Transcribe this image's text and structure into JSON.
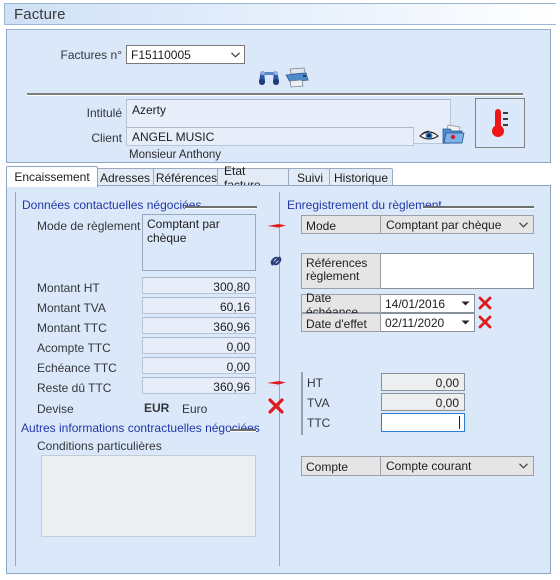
{
  "window": {
    "title": "Facture"
  },
  "header": {
    "facture_no_label": "Factures n°",
    "facture_no_value": "F15110005",
    "intitule_label": "Intitulé",
    "intitule_value": "Azerty",
    "client_label": "Client",
    "client_value": "ANGEL MUSIC",
    "client_contact": "Monsieur Anthony",
    "icons": {
      "search": "binoculars-icon",
      "print": "printer-icon",
      "preview": "eye-icon",
      "folder": "folder-icon",
      "thermometer": "thermometer-icon"
    }
  },
  "tabs": [
    {
      "label": "Encaissement",
      "active": true
    },
    {
      "label": "Adresses",
      "active": false
    },
    {
      "label": "Références",
      "active": false
    },
    {
      "label": "Etat facture",
      "active": false
    },
    {
      "label": "Suivi",
      "active": false
    },
    {
      "label": "Historique",
      "active": false
    }
  ],
  "left": {
    "group_title": "Données contactuelles négociées",
    "mode_label": "Mode de règlement",
    "mode_value": "Comptant par chèque",
    "amounts": [
      {
        "label": "Montant HT",
        "value": "300,80"
      },
      {
        "label": "Montant TVA",
        "value": "60,16"
      },
      {
        "label": "Montant TTC",
        "value": "360,96"
      },
      {
        "label": "Acompte TTC",
        "value": "0,00"
      },
      {
        "label": "Echéance TTC",
        "value": "0,00"
      },
      {
        "label": "Reste dû TTC",
        "value": "360,96"
      }
    ],
    "devise_label": "Devise",
    "devise_code": "EUR",
    "devise_name": "Euro",
    "other_group_title": "Autres informations contractuelles négociées",
    "conditions_label": "Conditions particulières",
    "conditions_value": ""
  },
  "right": {
    "group_title": "Enregistrement du règlement",
    "mode_label": "Mode",
    "mode_value": "Comptant par chèque",
    "references_label": "Références règlement",
    "references_value": "",
    "date_echeance_label": "Date échéance",
    "date_echeance_value": "14/01/2016",
    "date_effet_label": "Date d'effet",
    "date_effet_value": "02/11/2020",
    "ht_label": "HT",
    "ht_value": "0,00",
    "tva_label": "TVA",
    "tva_value": "0,00",
    "ttc_label": "TTC",
    "ttc_value": "",
    "compte_label": "Compte",
    "compte_value": "Compte courant"
  },
  "colors": {
    "panel_blue": "#dbe8f9",
    "group_title_blue": "#2238a8",
    "accent_red": "#e01b1b",
    "focus_blue": "#2a7fd4"
  }
}
